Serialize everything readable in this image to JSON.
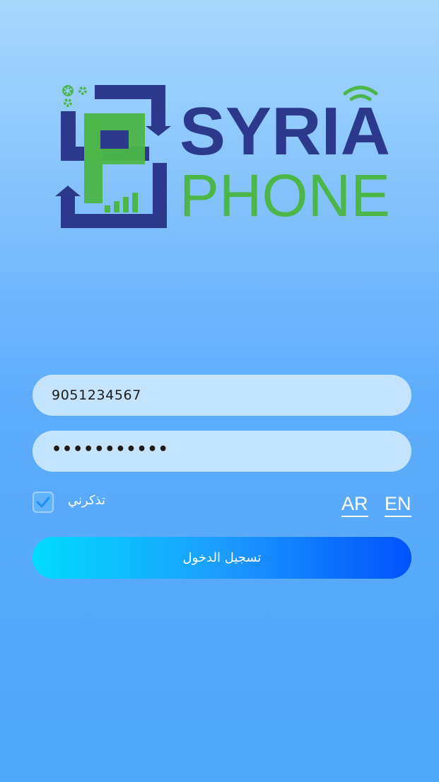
{
  "logo": {
    "line1": "SYRIA",
    "line2": "PHONE",
    "colors": {
      "blue": "#2c3a8e",
      "green": "#4cb648"
    }
  },
  "login_form": {
    "phone_value": "9051234567",
    "password_mask": "•••••••••••",
    "remember_me_label": "تذكرني",
    "remember_me_checked": true,
    "submit_label": "تسجيل الدخول"
  },
  "language": {
    "options": [
      "AR",
      "EN"
    ]
  },
  "colors": {
    "field_bg": "#c4e3fd",
    "button_gradient_start": "#00dcfe",
    "button_gradient_end": "#0052fd",
    "checkmark": "#1e8ff5"
  }
}
